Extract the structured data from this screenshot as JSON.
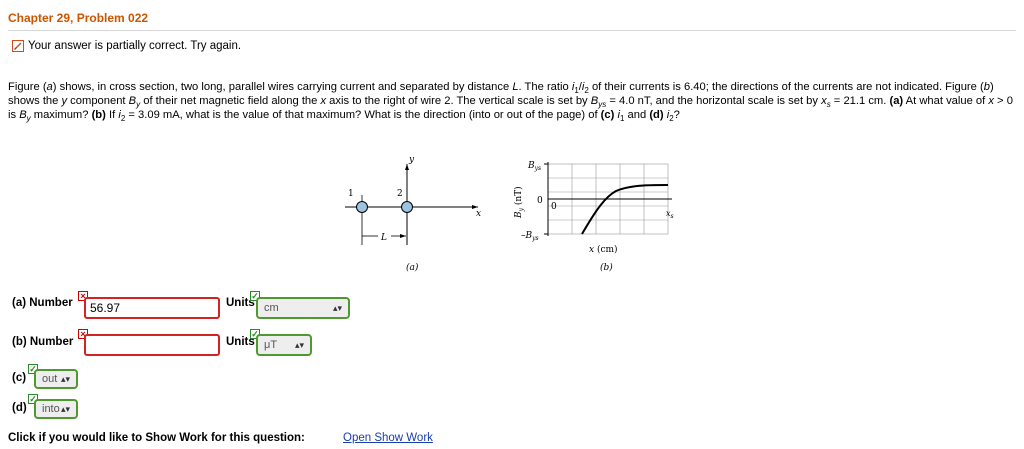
{
  "header": {
    "title": "Chapter 29, Problem 022"
  },
  "status": {
    "message": "Your answer is partially correct.  Try again."
  },
  "problem": {
    "segments": [
      {
        "t": "Figure ("
      },
      {
        "t": "a",
        "i": true
      },
      {
        "t": ") shows, in cross section, two long, parallel wires carrying current and separated by distance "
      },
      {
        "t": "L",
        "i": true
      },
      {
        "t": ". The ratio "
      },
      {
        "t": "i",
        "i": true
      },
      {
        "t": "1",
        "sub": true
      },
      {
        "t": "/"
      },
      {
        "t": "i",
        "i": true
      },
      {
        "t": "2",
        "sub": true
      },
      {
        "t": " of their currents is 6.40; the directions of the currents are not indicated. Figure ("
      },
      {
        "t": "b",
        "i": true
      },
      {
        "t": ") shows the "
      },
      {
        "t": "y",
        "i": true
      },
      {
        "t": " component "
      },
      {
        "t": "B",
        "i": true
      },
      {
        "t": "y",
        "sub": true,
        "i": true
      },
      {
        "t": " of their net magnetic field along the "
      },
      {
        "t": "x",
        "i": true
      },
      {
        "t": " axis to the right of wire 2. The vertical scale is set by "
      },
      {
        "t": "B",
        "i": true
      },
      {
        "t": "ys",
        "sub": true,
        "i": true
      },
      {
        "t": " = 4.0 nT, and the horizontal scale is set by "
      },
      {
        "t": "x",
        "i": true
      },
      {
        "t": "s",
        "sub": true,
        "i": true
      },
      {
        "t": " = 21.1 cm. "
      },
      {
        "t": "(a)",
        "b": true
      },
      {
        "t": " At what value of "
      },
      {
        "t": "x",
        "i": true
      },
      {
        "t": " > 0 is "
      },
      {
        "t": "B",
        "i": true
      },
      {
        "t": "y",
        "sub": true,
        "i": true
      },
      {
        "t": " maximum? "
      },
      {
        "t": "(b)",
        "b": true
      },
      {
        "t": " If "
      },
      {
        "t": "i",
        "i": true
      },
      {
        "t": "2",
        "sub": true
      },
      {
        "t": " = 3.09 mA, what is the value of that maximum? What is the direction (into or out of the page) of "
      },
      {
        "t": "(c)",
        "b": true
      },
      {
        "t": " "
      },
      {
        "t": "i",
        "i": true
      },
      {
        "t": "1",
        "sub": true
      },
      {
        "t": " and "
      },
      {
        "t": "(d)",
        "b": true
      },
      {
        "t": " "
      },
      {
        "t": "i",
        "i": true
      },
      {
        "t": "2",
        "sub": true
      },
      {
        "t": "?"
      }
    ]
  },
  "figure": {
    "a": {
      "caption": "(a)",
      "y": "y",
      "x": "x",
      "wire1": "1",
      "wire2": "2",
      "L": "L"
    },
    "b": {
      "caption": "(b)",
      "Bys": "B",
      "Bys_sub": "ys",
      "negBys": "–B",
      "zero_y": "0",
      "zero_x": "0",
      "xs": "x",
      "xs_sub": "s",
      "ylabel": "B (nT)",
      "ylabel_sub": "y",
      "xlabel": "x (cm)"
    }
  },
  "answers": {
    "a": {
      "label": "(a) Number",
      "value": "56.97",
      "units_label": "Units",
      "units": "cm",
      "number_correct": false,
      "units_correct": true
    },
    "b": {
      "label": "(b) Number",
      "value": "",
      "units_label": "Units",
      "units": "μT",
      "number_correct": false,
      "units_correct": true
    },
    "c": {
      "label": "(c)",
      "value": "out",
      "correct": true
    },
    "d": {
      "label": "(d)",
      "value": "into",
      "correct": true
    }
  },
  "footer": {
    "prompt": "Click if you would like to Show Work for this question:",
    "link": "Open Show Work"
  },
  "colors": {
    "title": "#cc5500",
    "wrong": "#d42323",
    "right": "#4f9a2f",
    "link": "#1a3fa8"
  }
}
